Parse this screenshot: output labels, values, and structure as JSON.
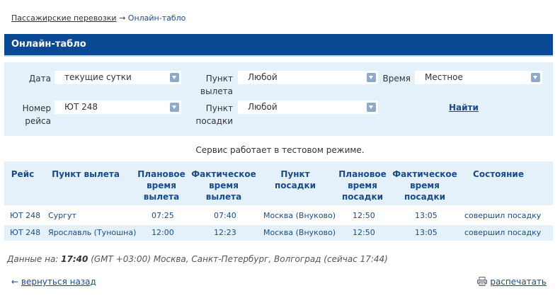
{
  "breadcrumb": {
    "parent": "Пассажирские перевозки",
    "separator": "→",
    "current": "Онлайн-табло"
  },
  "page_title": "Онлайн-табло",
  "filters": {
    "date_label": "Дата",
    "date_value": "текущие сутки",
    "departure_label_1": "Пункт",
    "departure_label_2": "вылета",
    "departure_value": "Любой",
    "time_label": "Время",
    "time_value": "Местное",
    "flight_label_1": "Номер",
    "flight_label_2": "рейса",
    "flight_value": "ЮТ 248",
    "arrival_label_1": "Пункт",
    "arrival_label_2": "посадки",
    "arrival_value": "Любой",
    "find_button": "Найти"
  },
  "notice": "Сервис работает в тестовом режиме.",
  "table": {
    "headers": {
      "flight": "Рейс",
      "departure_point": "Пункт вылета",
      "planned_dep_1": "Плановое",
      "planned_dep_2": "время",
      "planned_dep_3": "вылета",
      "actual_dep_1": "Фактическое",
      "actual_dep_2": "время",
      "actual_dep_3": "вылета",
      "arrival_point": "Пункт посадки",
      "planned_arr_1": "Плановое",
      "planned_arr_2": "время",
      "planned_arr_3": "посадки",
      "actual_arr_1": "Фактическое",
      "actual_arr_2": "время",
      "actual_arr_3": "посадки",
      "status": "Состояние"
    },
    "rows": [
      {
        "flight": "ЮТ 248",
        "departure_point": "Сургут",
        "planned_dep": "07:25",
        "actual_dep": "07:40",
        "arrival_point": "Москва (Внуково)",
        "planned_arr": "12:50",
        "actual_arr": "13:05",
        "status": "совершил посадку"
      },
      {
        "flight": "ЮТ 248",
        "departure_point": "Ярославль (Туношна)",
        "planned_dep": "12:00",
        "actual_dep": "12:23",
        "arrival_point": "Москва (Внуково)",
        "planned_arr": "12:50",
        "actual_arr": "13:05",
        "status": "совершил посадку"
      }
    ]
  },
  "footer": {
    "data_on_label": "Данные на:",
    "data_time": "17:40",
    "data_tz": "(GMT +03:00) Москва, Санкт-Петербург, Волгоград (сейчас 17:44)",
    "back_arrow": "←",
    "back_label": "вернуться назад",
    "print_label": "распечатать"
  },
  "icons": {
    "dropdown": "chevron-down-icon",
    "print": "printer-icon"
  },
  "colors": {
    "header_bg": "#0a4a95",
    "light_bg": "#e4f1fa",
    "link": "#1a4b8c"
  }
}
